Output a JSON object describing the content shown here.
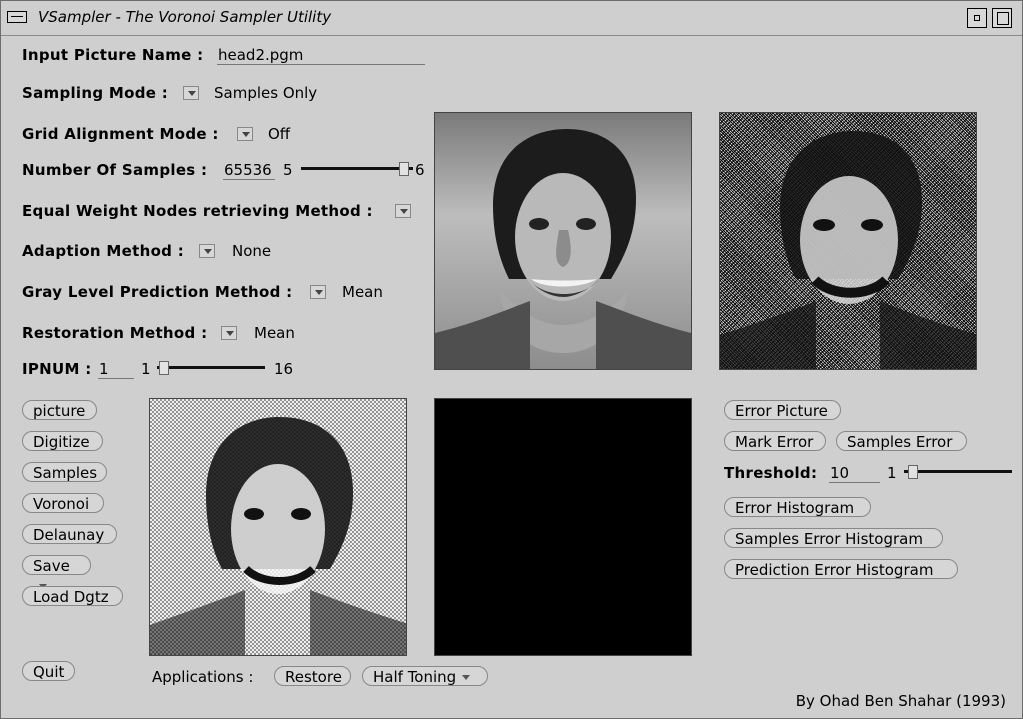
{
  "window": {
    "title": "VSampler - The Voronoi Sampler Utility"
  },
  "form": {
    "input_picture_name_label": "Input Picture Name :",
    "input_picture_name_value": "head2.pgm",
    "sampling_mode_label": "Sampling Mode :",
    "sampling_mode_value": "Samples Only",
    "grid_alignment_mode_label": "Grid Alignment Mode :",
    "grid_alignment_mode_value": "Off",
    "number_of_samples_label": "Number Of Samples :",
    "number_of_samples_value": "65536",
    "number_of_samples_min": "5",
    "number_of_samples_max_tick": "6",
    "equal_weight_label": "Equal Weight Nodes retrieving Method :",
    "adaption_method_label": "Adaption Method :",
    "adaption_method_value": "None",
    "gray_level_label": "Gray Level Prediction Method :",
    "gray_level_value": "Mean",
    "restoration_label": "Restoration Method :",
    "restoration_value": "Mean",
    "ipnum_label": "IPNUM :",
    "ipnum_value": "1",
    "ipnum_min": "1",
    "ipnum_max": "16"
  },
  "left_buttons": {
    "picture": "picture",
    "digitize": "Digitize",
    "samples": "Samples",
    "voronoi": "Voronoi",
    "delaunay": "Delaunay",
    "save": "Save",
    "load_dgtz": "Load Dgtz",
    "quit": "Quit"
  },
  "right_controls": {
    "error_picture": "Error Picture",
    "mark_error": "Mark Error",
    "samples_error": "Samples Error",
    "threshold_label": "Threshold:",
    "threshold_value": "10",
    "threshold_min": "1",
    "error_histogram": "Error Histogram",
    "samples_error_histogram": "Samples Error Histogram",
    "prediction_error_histogram": "Prediction Error Histogram"
  },
  "applications": {
    "label": "Applications :",
    "restore": "Restore",
    "half_toning": "Half Toning"
  },
  "footer": {
    "credit": "By Ohad Ben Shahar (1993)"
  }
}
